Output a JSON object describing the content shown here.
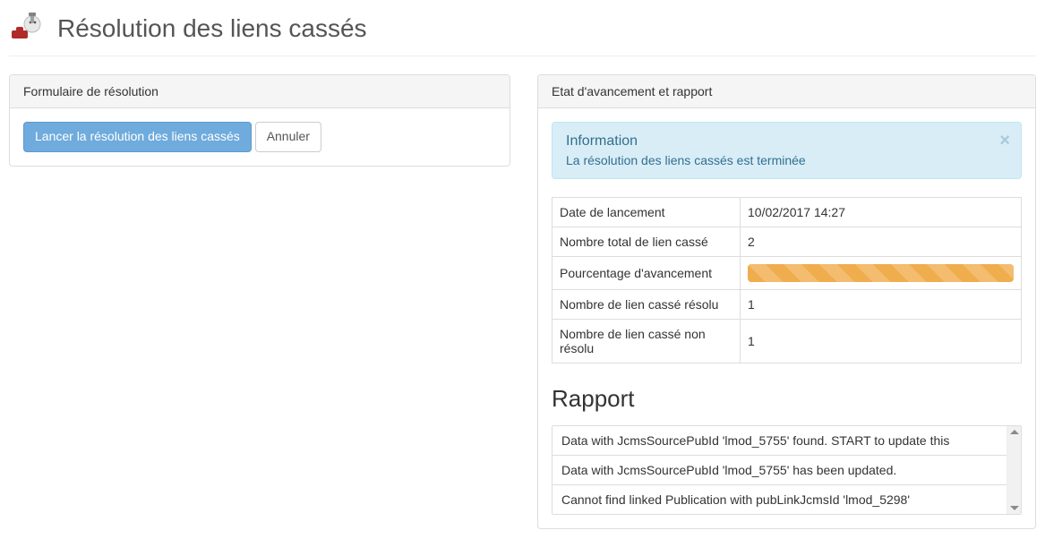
{
  "page_title": "Résolution des liens cassés",
  "form_panel": {
    "title": "Formulaire de résolution",
    "launch_label": "Lancer la résolution des liens cassés",
    "cancel_label": "Annuler"
  },
  "status_panel": {
    "title": "Etat d'avancement et rapport",
    "alert": {
      "title": "Information",
      "message": "La résolution des liens cassés est terminée",
      "close_glyph": "×"
    },
    "rows": {
      "launch_date_label": "Date de lancement",
      "launch_date_value": "10/02/2017 14:27",
      "total_label": "Nombre total de lien cassé",
      "total_value": "2",
      "progress_label": "Pourcentage d'avancement",
      "progress_percent": 100,
      "resolved_label": "Nombre de lien cassé résolu",
      "resolved_value": "1",
      "unresolved_label": "Nombre de lien cassé non résolu",
      "unresolved_value": "1"
    },
    "report_heading": "Rapport",
    "report_items": [
      "Data with JcmsSourcePubId 'lmod_5755' found. START to update this",
      "Data with JcmsSourcePubId 'lmod_5755' has been updated.",
      "Cannot find linked Publication with pubLinkJcmsId 'lmod_5298'"
    ]
  }
}
